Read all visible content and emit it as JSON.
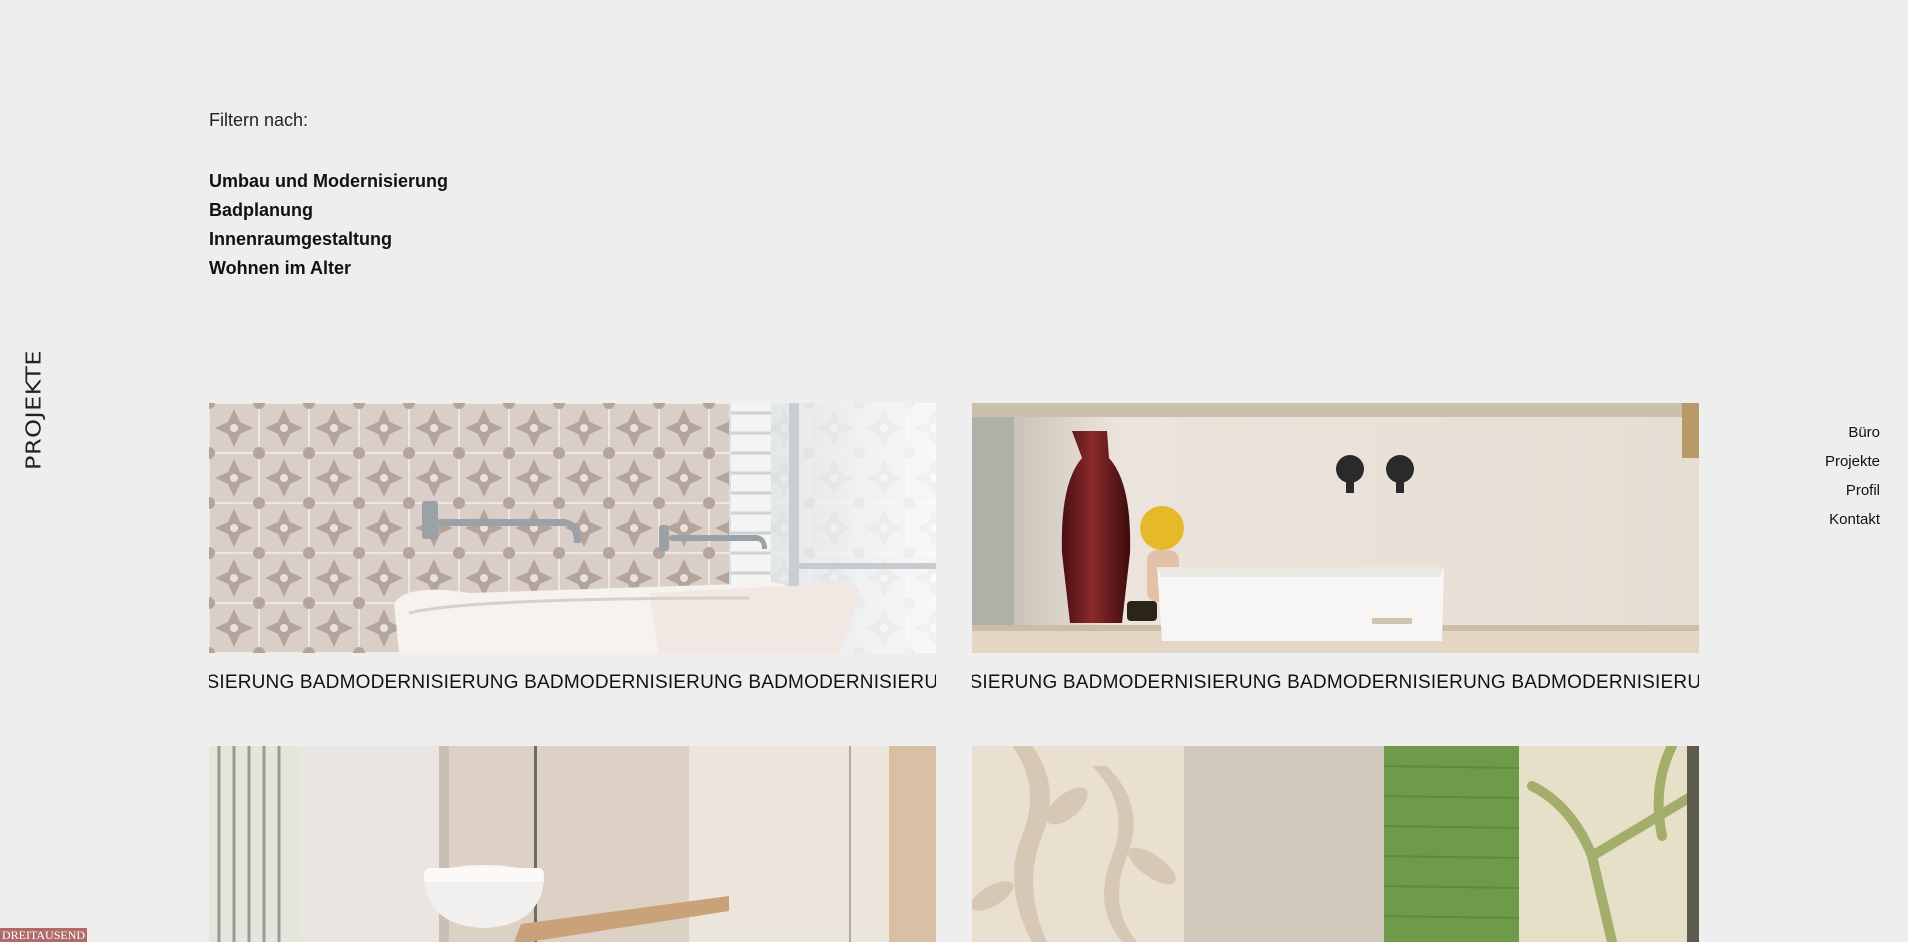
{
  "filter": {
    "label": "Filtern nach:",
    "options": [
      "Umbau und Modernisierung",
      "Badplanung",
      "Innenraumgestaltung",
      "Wohnen im Alter"
    ]
  },
  "side_title": "PROJEKTE",
  "nav": {
    "items": [
      "Büro",
      "Projekte",
      "Profil",
      "Kontakt"
    ]
  },
  "projects": [
    {
      "caption": "ISIERUNG BADMODERNISIERUNG BADMODERNISIERUNG BADMODERNISIERUNG BADMODERNISIERUNG BADM"
    },
    {
      "caption": "ISIERUNG BADMODERNISIERUNG BADMODERNISIERUNG BADMODERNISIERUNG BADMODERNISIERUNG BADM"
    },
    {
      "caption": ""
    },
    {
      "caption": ""
    }
  ],
  "footer_badge": "DREITAUSEND",
  "colors": {
    "background": "#eeeeee",
    "text": "#111111",
    "badge": "#b06a6a"
  }
}
